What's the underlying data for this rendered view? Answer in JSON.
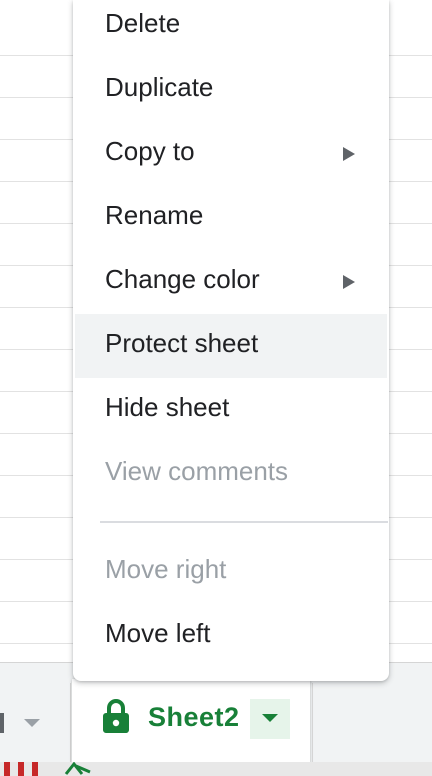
{
  "menu": {
    "items": [
      {
        "label": "Delete",
        "enabled": true,
        "submenu": false
      },
      {
        "label": "Duplicate",
        "enabled": true,
        "submenu": false
      },
      {
        "label": "Copy to",
        "enabled": true,
        "submenu": true
      },
      {
        "label": "Rename",
        "enabled": true,
        "submenu": false
      },
      {
        "label": "Change color",
        "enabled": true,
        "submenu": true
      },
      {
        "label": "Protect sheet",
        "enabled": true,
        "submenu": false,
        "highlighted": true
      },
      {
        "label": "Hide sheet",
        "enabled": true,
        "submenu": false
      },
      {
        "label": "View comments",
        "enabled": false,
        "submenu": false
      },
      {
        "label": "Move right",
        "enabled": false,
        "submenu": false
      },
      {
        "label": "Move left",
        "enabled": true,
        "submenu": false
      }
    ]
  },
  "sheet_tabs": {
    "active": {
      "name": "Sheet2",
      "icon": "lock-icon",
      "color": "#188038"
    }
  },
  "colors": {
    "menu_hover": "#f1f3f4",
    "disabled_text": "#9aa0a6",
    "accent_green": "#188038"
  }
}
